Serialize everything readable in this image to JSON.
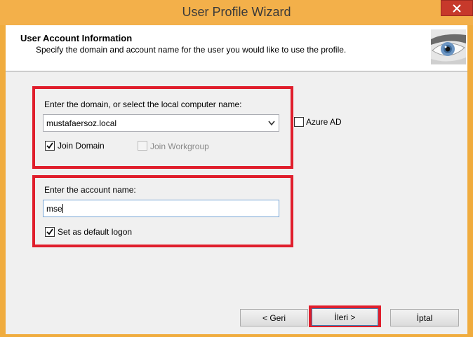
{
  "window": {
    "title": "User Profile Wizard",
    "close_icon": "close-icon"
  },
  "header": {
    "title": "User Account Information",
    "subtitle": "Specify the domain and account name for the user you would like to use the profile.",
    "image_icon": "eye-icon"
  },
  "domain_section": {
    "label": "Enter the domain, or select the local computer name:",
    "domain_value": "mustafaersoz.local",
    "azure_ad_label": "Azure AD",
    "azure_ad_checked": false,
    "join_domain_label": "Join Domain",
    "join_domain_checked": true,
    "join_workgroup_label": "Join Workgroup",
    "join_workgroup_checked": false
  },
  "account_section": {
    "label": "Enter the account name:",
    "account_value": "mse",
    "default_logon_label": "Set as default logon",
    "default_logon_checked": true
  },
  "footer": {
    "back_label": "< Geri",
    "next_label": "İleri >",
    "cancel_label": "İptal"
  },
  "colors": {
    "highlight": "#e01e2c",
    "titlebar": "#f3b04a",
    "close": "#c7392b"
  }
}
